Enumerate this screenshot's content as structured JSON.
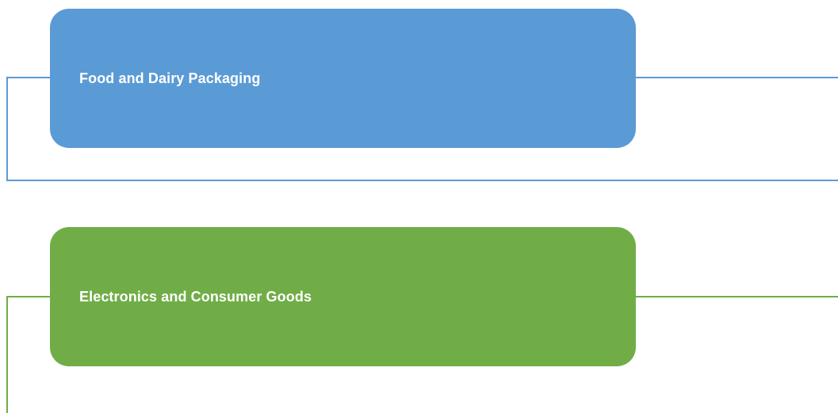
{
  "colors": {
    "blue": "#5B9BD5",
    "green": "#70AD47",
    "text": "#FFFFFF"
  },
  "nodes": [
    {
      "label": "Food and Dairy Packaging",
      "color": "#5B9BD5"
    },
    {
      "label": "Electronics and Consumer Goods",
      "color": "#70AD47"
    }
  ]
}
